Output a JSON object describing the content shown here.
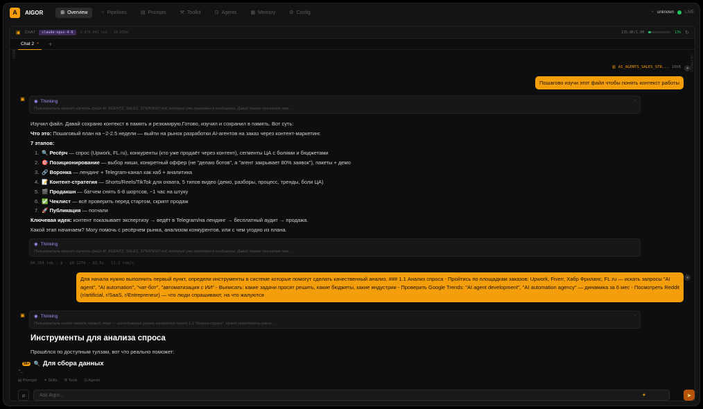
{
  "app": {
    "logo_letter": "A",
    "name": "AIGOR"
  },
  "nav": {
    "tabs": [
      {
        "label": "Overview",
        "icon": "grid-icon"
      },
      {
        "label": "Pipelines",
        "icon": "pipeline-icon"
      },
      {
        "label": "Prompts",
        "icon": "prompt-icon"
      },
      {
        "label": "Toolkit",
        "icon": "wrench-icon"
      },
      {
        "label": "Agents",
        "icon": "robot-icon"
      },
      {
        "label": "Memory",
        "icon": "database-icon"
      },
      {
        "label": "Config",
        "icon": "gear-icon"
      }
    ],
    "user": "unknown",
    "status": "LIVE"
  },
  "chatbar": {
    "label": "CHAT",
    "model": "claude-opus-4-6",
    "stats": "1,878,441 tok · $4,859a",
    "context": "135.8K/1.0M",
    "context_fraction": 0.135,
    "percent": "13%"
  },
  "tab": {
    "label": "Chat 2",
    "close": "×",
    "add": "+"
  },
  "side": {
    "left": "NEXT",
    "right": "SETTINGS"
  },
  "file": {
    "name": "AI_AGENTS_SALES_STR...",
    "size": "10KB"
  },
  "messages": {
    "user1": "Пошагово изучи этот файл чтобы понять контекст работы",
    "thinking_label": "Thinking",
    "think1": "Пользователь просит изучить файл AI_AGENTS_SALES_STRATEGY.md, который уже приложен в сообщении. Давай также прочитаю нам...",
    "answer": {
      "intro": "Изучил файл. Давай сохраню контекст в память и резюмирую.Готово, изучил и сохранил в память. Вот суть:",
      "what_label": "Что это:",
      "what_text": "Пошаговый план на ~2-2.5 недели — выйти на рынок разработки AI-агентов на заказ через контент-маркетинг.",
      "stages_label": "7 этапов:",
      "stages": [
        {
          "num": "1.",
          "emoji": "🔍",
          "title": "Ресёрч",
          "text": " — спрос (Upwork, FL.ru), конкуренты (кто уже продаёт через контент), сегменты ЦА с болями и бюджетами"
        },
        {
          "num": "2.",
          "emoji": "🎯",
          "title": "Позиционирование",
          "text": " — выбор ниши, конкретный оффер (не \"делаю ботов\", а \"агент закрывает 80% заявок\"), пакеты + демо"
        },
        {
          "num": "3.",
          "emoji": "🔗",
          "title": "Воронка",
          "text": " — лендинг + Telegram-канал как хаб + аналитика"
        },
        {
          "num": "4.",
          "emoji": "📝",
          "title": "Контент-стратегия",
          "text": " — Shorts/Reels/TikTok для охвата, 5 типов видео (демо, разборы, процесс, тренды, боли ЦА)"
        },
        {
          "num": "5.",
          "emoji": "🎬",
          "title": "Продакшн",
          "text": " — батчем снять 6-8 шортсов, ~1 час на штуку"
        },
        {
          "num": "6.",
          "emoji": "✅",
          "title": "Чеклист",
          "text": " — всё проверить перед стартом, скрипт продаж"
        },
        {
          "num": "7.",
          "emoji": "🚀",
          "title": "Публикация",
          "text": " — погнали"
        }
      ],
      "key_label": "Ключевая идея:",
      "key_text": "контент показывает экспертизу → ведёт в Telegram/на лендинг → бесплатный аудит → продажа.",
      "question": "Какой этап начинаем? Могу помочь с ресёрчем рынка, анализом конкурентов, или с чем угодно из плана."
    },
    "think2": "Пользователь просит изучить файл AI_AGENTS_SALES_STRATEGY.md, который уже приложен в сообщении. Давай также прочитаю нам...",
    "meta": "60,354 tok · $ · $0.1270 · 92.5s · 11.2 tok/s",
    "user2": "Для начала нужно выполнить первый пункт, определи инструменты в системе которые помогут сделать качественный анализ. ### 1.1 Анализ спроса - Пройтись по площадкам заказов: Upwork, Fiverr, Хабр Фриланс, FL.ru — искать запросы \"AI agent\", \"AI automation\", \"чат-бот\", \"автоматизация с ИИ\" - Выписать: какие задачи просят решить, какие бюджеты, какие индустрии - Проверить Google Trends: \"AI agent development\", \"AI automation agency\" — динамика за 6 мес - Посмотреть Reddit (r/artificial, r/SaaS, r/Entrepreneur) — что люди спрашивают, на что жалуются",
    "think3": "Пользователь хочет начать первый этап — исследование рынка, конкретно пункт 1.1 \"Анализ спроса\". Нужно определить какие ...",
    "heading": "Инструменты для анализа спроса",
    "para": "Прошёлся по доступным тулзам, вот что реально поможет:",
    "badge": "99+",
    "subheading": "Для сбора данных"
  },
  "toolbar": {
    "items": [
      {
        "label": "Prompts",
        "icon": "prompt-icon"
      },
      {
        "label": "Skills",
        "icon": "sparkle-icon"
      },
      {
        "label": "Tools",
        "icon": "wrench-icon"
      },
      {
        "label": "Agents",
        "icon": "robot-icon"
      }
    ]
  },
  "composer": {
    "placeholder": "Ask Aigor..."
  },
  "colors": {
    "accent": "#f59e0b",
    "thinking": "#a78bfa",
    "live": "#22c55e"
  }
}
